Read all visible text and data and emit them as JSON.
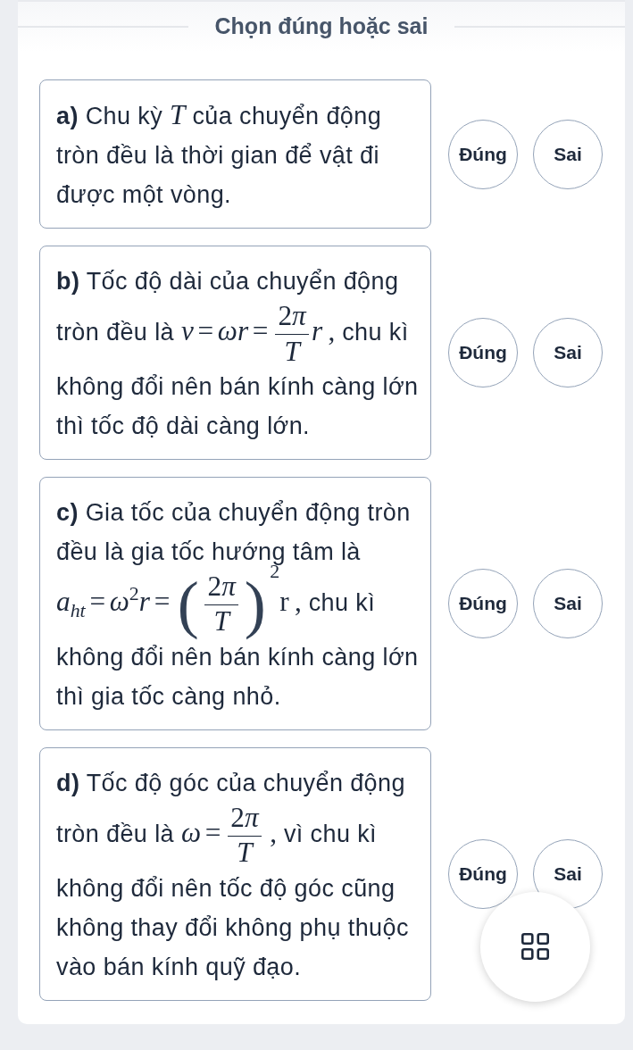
{
  "title": "Chọn đúng hoặc sai",
  "statements": [
    {
      "label": "a)",
      "segments": [
        {
          "kind": "text",
          "text": "Chu kỳ "
        },
        {
          "kind": "math",
          "parts": [
            {
              "kind": "var",
              "text": "T"
            }
          ]
        },
        {
          "kind": "text",
          "text": " của chuyển động tròn đều là thời gian để vật đi được một vòng."
        }
      ],
      "options": [
        {
          "label": "Đúng",
          "selected": false
        },
        {
          "label": "Sai",
          "selected": false
        }
      ]
    },
    {
      "label": "b)",
      "segments": [
        {
          "kind": "text",
          "text": "Tốc độ dài của chuyển động tròn đều là "
        },
        {
          "kind": "math",
          "parts": [
            {
              "kind": "var",
              "text": "v"
            },
            {
              "kind": "op",
              "text": "="
            },
            {
              "kind": "var",
              "text": "ω"
            },
            {
              "kind": "var",
              "text": "r"
            },
            {
              "kind": "op",
              "text": "="
            },
            {
              "kind": "frac",
              "num": [
                {
                  "kind": "num",
                  "text": "2"
                },
                {
                  "kind": "var",
                  "text": "π"
                }
              ],
              "den": [
                {
                  "kind": "var",
                  "text": "T"
                }
              ]
            },
            {
              "kind": "var",
              "text": "r"
            },
            {
              "kind": "punct",
              "text": ","
            }
          ]
        },
        {
          "kind": "text",
          "text": " chu kì không đổi nên bán kính càng lớn thì tốc độ dài càng lớn."
        }
      ],
      "options": [
        {
          "label": "Đúng",
          "selected": false
        },
        {
          "label": "Sai",
          "selected": false
        }
      ]
    },
    {
      "label": "c)",
      "segments": [
        {
          "kind": "text",
          "text": "Gia tốc của chuyển động tròn đều là gia tốc hướng tâm là "
        },
        {
          "kind": "math",
          "parts": [
            {
              "kind": "var",
              "text": "a"
            },
            {
              "kind": "sub",
              "text": "ht"
            },
            {
              "kind": "op",
              "text": "="
            },
            {
              "kind": "var",
              "text": "ω"
            },
            {
              "kind": "sup",
              "text": "2"
            },
            {
              "kind": "var",
              "text": "r"
            },
            {
              "kind": "op",
              "text": "="
            },
            {
              "kind": "delim",
              "text": "("
            },
            {
              "kind": "frac",
              "num": [
                {
                  "kind": "num",
                  "text": "2"
                },
                {
                  "kind": "var",
                  "text": "π"
                }
              ],
              "den": [
                {
                  "kind": "var",
                  "text": "T"
                }
              ]
            },
            {
              "kind": "delim",
              "text": ")"
            },
            {
              "kind": "sup",
              "text": "2"
            },
            {
              "kind": "rm",
              "text": "r"
            },
            {
              "kind": "punct",
              "text": ","
            }
          ]
        },
        {
          "kind": "text",
          "text": " chu kì không đổi nên bán kính càng lớn thì gia tốc càng nhỏ."
        }
      ],
      "options": [
        {
          "label": "Đúng",
          "selected": false
        },
        {
          "label": "Sai",
          "selected": false
        }
      ]
    },
    {
      "label": "d)",
      "segments": [
        {
          "kind": "text",
          "text": "Tốc độ góc của chuyển động tròn đều là "
        },
        {
          "kind": "math",
          "parts": [
            {
              "kind": "var",
              "text": "ω"
            },
            {
              "kind": "op",
              "text": "="
            },
            {
              "kind": "frac",
              "num": [
                {
                  "kind": "num",
                  "text": "2"
                },
                {
                  "kind": "var",
                  "text": "π"
                }
              ],
              "den": [
                {
                  "kind": "var",
                  "text": "T"
                }
              ]
            },
            {
              "kind": "punct",
              "text": ","
            }
          ]
        },
        {
          "kind": "text",
          "text": " vì chu kì không đổi nên tốc độ góc cũng không thay đổi không phụ thuộc vào bán kính quỹ đạo."
        }
      ],
      "options": [
        {
          "label": "Đúng",
          "selected": false
        },
        {
          "label": "Sai",
          "selected": false
        }
      ]
    }
  ]
}
